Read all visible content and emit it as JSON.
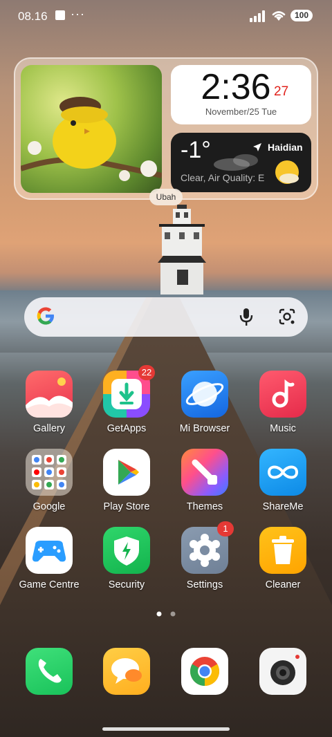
{
  "status": {
    "time": "08.16",
    "dots": "···",
    "battery": "100"
  },
  "widget": {
    "clock_time": "2:36",
    "clock_seconds": "27",
    "date": "November/25 Tue",
    "temperature": "-1°",
    "location": "Haidian",
    "weather_desc": "Clear, Air Quality: E",
    "edit_label": "Ubah"
  },
  "apps": [
    {
      "label": "Gallery"
    },
    {
      "label": "GetApps",
      "badge": "22"
    },
    {
      "label": "Mi Browser"
    },
    {
      "label": "Music"
    },
    {
      "label": "Google"
    },
    {
      "label": "Play Store"
    },
    {
      "label": "Themes"
    },
    {
      "label": "ShareMe"
    },
    {
      "label": "Game Centre"
    },
    {
      "label": "Security"
    },
    {
      "label": "Settings",
      "badge": "1"
    },
    {
      "label": "Cleaner"
    }
  ],
  "dock": [
    "phone-icon",
    "messaging-icon",
    "chrome-icon",
    "camera-icon"
  ],
  "colors": {
    "clock_seconds": "#e0211b",
    "badge": "#e53935"
  }
}
